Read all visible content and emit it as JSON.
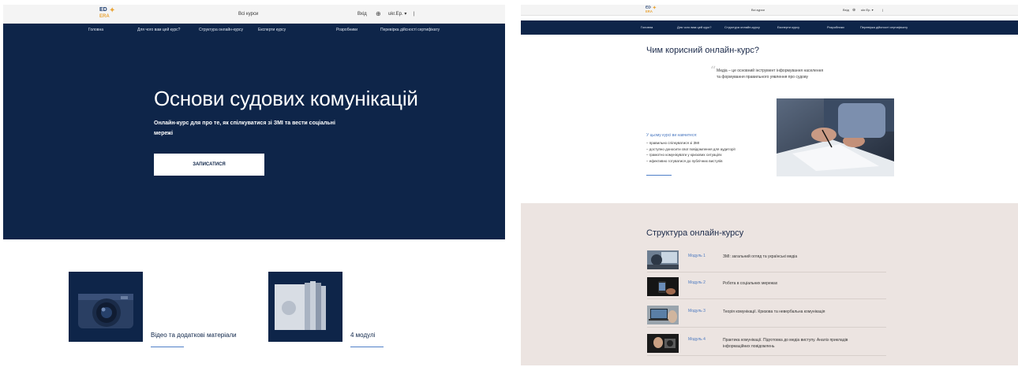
{
  "left": {
    "header": {
      "logo_top": "ED",
      "logo_bottom": "ERA",
      "title": "Всі курси",
      "login": "Вхід",
      "lang": "ukr.Ер. ▾",
      "separator": "|"
    },
    "nav": [
      "Головна",
      "Для чого вам цей курс?",
      "Структура онлайн-курсу",
      "Експерти курсу",
      "Розробники",
      "Перевірка дійсності сертифікату"
    ],
    "hero": {
      "title": "Основи судових комунікацій",
      "subtitle": "Онлайн-курс для про те, як спілкуватися зі ЗМІ та вести соціальні мережі",
      "button": "ЗАПИСАТИСЯ"
    },
    "cards": [
      {
        "label": "Відео та додаткові матеріали",
        "icon": "camera-icon"
      },
      {
        "label": "4 модулі",
        "icon": "books-icon"
      }
    ]
  },
  "right": {
    "header": {
      "logo_top": "ED",
      "logo_bottom": "ERA",
      "title": "Всі курси",
      "login": "Вхід",
      "lang": "ukr.Ер. ▾",
      "separator": "|"
    },
    "nav": [
      "Головна",
      "Для чого вам цей курс?",
      "Структура онлайн-курсу",
      "Експерти курсу",
      "Розробники",
      "Перевірка дійсності сертифікату"
    ],
    "why": {
      "title": "Чим корисний онлайн-курс?",
      "quote": "Медіа – це основний інструмент інформування населення та формування правильного уявлення про судову",
      "learn_title": "У цьому курсі ви навчитеся:",
      "learn_items": [
        "– правильно спілкуватися зі ЗМІ",
        "– доступно доносити свої повідомлення для аудиторії",
        "– грамотно комунікувати у кризових ситуаціях",
        "– ефективно готуватися до публічних виступів"
      ]
    },
    "structure": {
      "title": "Структура онлайн-курсу",
      "modules": [
        {
          "num": "Модуль 1",
          "title": "ЗМІ: загальний огляд та українські медіа"
        },
        {
          "num": "Модуль 2",
          "title": "Робота в соціальних мережах"
        },
        {
          "num": "Модуль 3",
          "title": "Теорія комунікації. Кризова та невербальна комунікація"
        },
        {
          "num": "Модуль 4",
          "title": "Практика комунікації. Підготовка до медіа виступу. Аналіз прикладів інформаційних повідомлень"
        }
      ]
    }
  },
  "colors": {
    "navy": "#0e2549",
    "accent_blue": "#4a78c0",
    "logo_orange": "#e9a53a",
    "structure_bg": "#ece4e1"
  }
}
